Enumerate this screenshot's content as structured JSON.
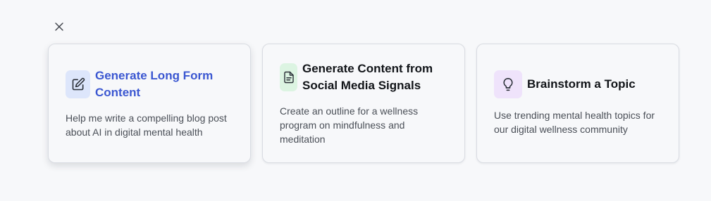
{
  "dialog": {
    "close_label": "close"
  },
  "cards": [
    {
      "title": "Generate Long Form Content",
      "description": "Help me write a compelling blog post about AI in digital mental health",
      "icon": "pencil-square-icon"
    },
    {
      "title": "Generate Content from Social Media Signals",
      "description": "Create an outline for a wellness program on mindfulness and meditation",
      "icon": "document-icon"
    },
    {
      "title": "Brainstorm a Topic",
      "description": "Use trending mental health topics for our digital wellness community",
      "icon": "lightbulb-icon"
    }
  ],
  "colors": {
    "accent": "#3b57d1",
    "icon_bg_blue": "#dde6fb",
    "icon_bg_green": "#dcf4e2",
    "icon_bg_purple": "#efe3fb"
  }
}
